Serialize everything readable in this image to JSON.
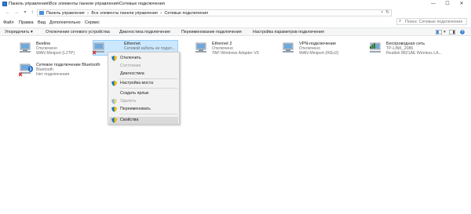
{
  "window": {
    "title": "Панель управления\\Все элементы панели управления\\Сетевые подключения",
    "buttons": {
      "minimize": "—",
      "maximize": "☐",
      "close": "✕"
    }
  },
  "address": {
    "back": "←",
    "forward": "→",
    "up": "↑",
    "crumbs": [
      "Панель управления",
      "›",
      "Все элементы панели управления",
      "›",
      "Сетевые подключения"
    ],
    "refresh": "↻",
    "search_placeholder": "Поиск: Сетевые подключения"
  },
  "menu": [
    "Файл",
    "Правка",
    "Вид",
    "Дополнительно",
    "Сервис"
  ],
  "toolbar": {
    "organize": "Упорядочить ▾",
    "items": [
      "Отключение сетевого устройства",
      "Диагностика подключения",
      "Переименование подключения",
      "Настройка параметров подключения"
    ]
  },
  "connections": [
    {
      "name": "Beeline",
      "status": "Отключено",
      "device": "WAN Miniport (L2TP)"
    },
    {
      "name": "Ethernet",
      "status": "Сетевой кабель не подкл...",
      "device": ""
    },
    {
      "name": "Ethernet 2",
      "status": "Отключено",
      "device": "TAP-Windows Adapter V9"
    },
    {
      "name": "VPN-подключение",
      "status": "Отключено",
      "device": "WAN Miniport (IKEv2)"
    },
    {
      "name": "Беспроводная сеть",
      "status": "TP-LINK_2086",
      "device": "Realtek 8821AE Wireless LA..."
    },
    {
      "name": "Сетевое подключение Bluetooth",
      "status": "Нет подключения",
      "device": ""
    }
  ],
  "context_menu": [
    {
      "label": "Отключить",
      "enabled": true,
      "shield": true
    },
    {
      "label": "Состояние",
      "enabled": false,
      "shield": false
    },
    {
      "label": "Диагностика",
      "enabled": true,
      "shield": false
    },
    {
      "label": "Настройка моста",
      "enabled": true,
      "shield": true
    },
    {
      "label": "Создать ярлык",
      "enabled": true,
      "shield": false
    },
    {
      "label": "Удалить",
      "enabled": false,
      "shield": true
    },
    {
      "label": "Переименовать",
      "enabled": true,
      "shield": true
    },
    {
      "label": "Свойства",
      "enabled": true,
      "shield": true
    }
  ],
  "colors": {
    "selection": "#cce8ff",
    "accent": "#2a7ad2",
    "error": "#d32f2f"
  }
}
